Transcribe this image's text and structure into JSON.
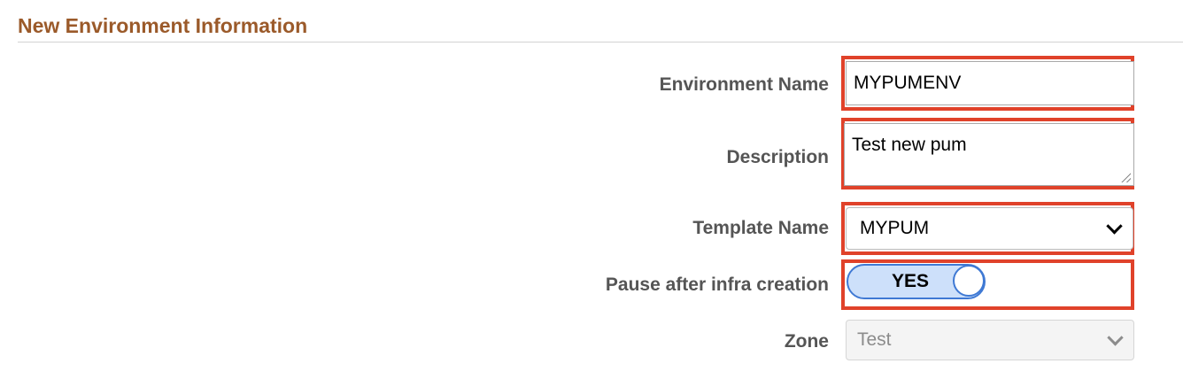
{
  "section": {
    "title": "New Environment Information"
  },
  "fields": {
    "environment_name": {
      "label": "Environment Name",
      "value": "MYPUMENV"
    },
    "description": {
      "label": "Description",
      "value": "Test new pum"
    },
    "template_name": {
      "label": "Template Name",
      "value": "MYPUM"
    },
    "pause_after_infra": {
      "label": "Pause after infra creation",
      "value": "YES"
    },
    "zone": {
      "label": "Zone",
      "value": "Test"
    }
  },
  "colors": {
    "section_title": "#9b5a2a",
    "highlight": "#e0422a",
    "toggle_fill": "#cde0fa",
    "toggle_border": "#3f79d4"
  }
}
